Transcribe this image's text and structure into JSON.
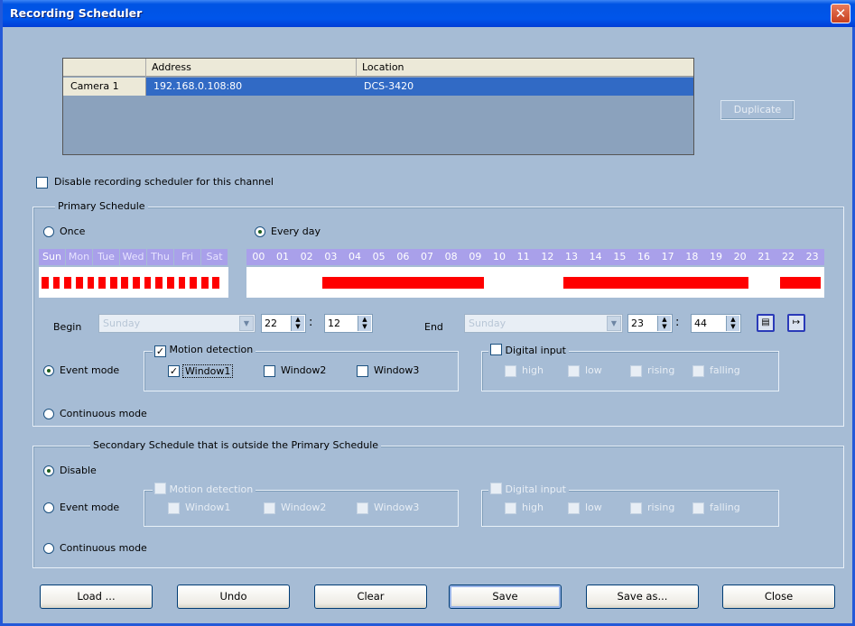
{
  "window": {
    "title": "Recording Scheduler",
    "close_glyph": "✕"
  },
  "cameras": {
    "columns": [
      "",
      "Address",
      "Location"
    ],
    "rows": [
      {
        "name": "Camera 1",
        "address": "192.168.0.108:80",
        "location": "DCS-3420"
      }
    ]
  },
  "duplicate_label": "Duplicate",
  "disable_channel_label": "Disable recording scheduler for this channel",
  "primary": {
    "title": "Primary Schedule",
    "once_label": "Once",
    "everyday_label": "Every day",
    "days": [
      "Sun",
      "Mon",
      "Tue",
      "Wed",
      "Thu",
      "Fri",
      "Sat"
    ],
    "hours": [
      "00",
      "01",
      "02",
      "03",
      "04",
      "05",
      "06",
      "07",
      "08",
      "09",
      "10",
      "11",
      "12",
      "13",
      "14",
      "15",
      "16",
      "17",
      "18",
      "19",
      "20",
      "21",
      "22",
      "23"
    ],
    "scheduled_hours": [
      [
        3,
        9
      ],
      [
        13,
        20
      ],
      [
        22,
        23
      ]
    ],
    "begin_label": "Begin",
    "begin_day": "Sunday",
    "begin_hour": "22",
    "begin_minute": "12",
    "end_label": "End",
    "end_day": "Sunday",
    "end_hour": "23",
    "end_minute": "44",
    "event_mode_label": "Event mode",
    "continuous_mode_label": "Continuous mode",
    "motion_label": "Motion detection",
    "windows": [
      "Window1",
      "Window2",
      "Window3"
    ],
    "digital_label": "Digital input",
    "digital_options": [
      "high",
      "low",
      "rising",
      "falling"
    ]
  },
  "secondary": {
    "title": "Secondary Schedule that is outside the Primary Schedule",
    "disable_label": "Disable",
    "event_mode_label": "Event mode",
    "continuous_mode_label": "Continuous mode",
    "motion_label": "Motion detection",
    "windows": [
      "Window1",
      "Window2",
      "Window3"
    ],
    "digital_label": "Digital input",
    "digital_options": [
      "high",
      "low",
      "rising",
      "falling"
    ]
  },
  "buttons": {
    "load": "Load ...",
    "undo": "Undo",
    "clear": "Clear",
    "save": "Save",
    "save_as": "Save as...",
    "close": "Close"
  },
  "colors": {
    "title_bar": "#0055ea",
    "window_bg": "#a6bcd5",
    "schedule_bar": "#ff0000",
    "day_header": "#a9a0ea",
    "selected_row": "#316ac5"
  }
}
